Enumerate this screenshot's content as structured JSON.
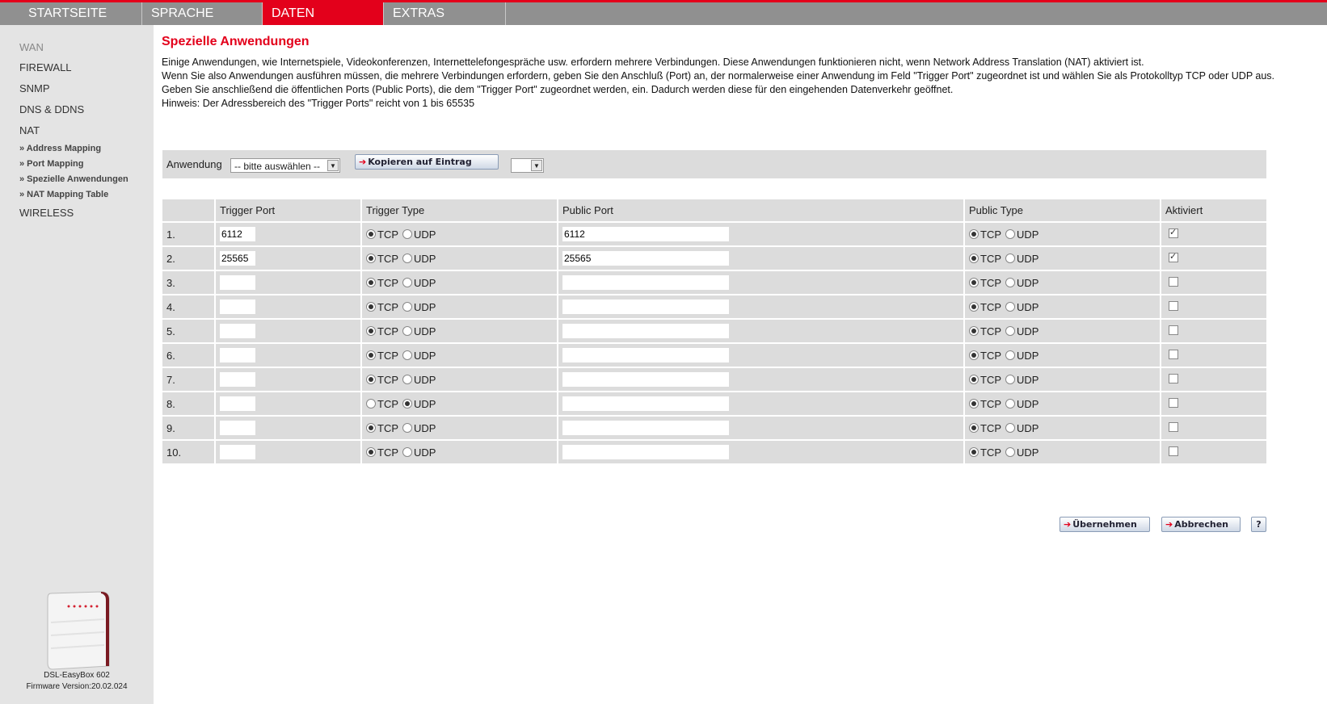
{
  "nav": {
    "tabs": [
      {
        "label": "STARTSEITE",
        "active": false
      },
      {
        "label": "SPRACHE",
        "active": false
      },
      {
        "label": "DATEN",
        "active": true
      },
      {
        "label": "EXTRAS",
        "active": false
      }
    ]
  },
  "sidebar": {
    "items": [
      "WAN",
      "FIREWALL",
      "SNMP",
      "DNS & DDNS",
      "NAT",
      "WIRELESS"
    ],
    "subitems": [
      "» Address Mapping",
      "» Port Mapping",
      "» Spezielle Anwendungen",
      "» NAT Mapping Table"
    ],
    "device_name": "DSL-EasyBox 602",
    "firmware": "Firmware Version:20.02.024"
  },
  "main": {
    "title": "Spezielle Anwendungen",
    "intro": [
      "Einige Anwendungen, wie Internetspiele, Videokonferenzen, Internettelefongespräche usw. erfordern mehrere Verbindungen. Diese Anwendungen funktionieren nicht, wenn Network Address Translation (NAT) aktiviert ist.",
      "Wenn Sie also Anwendungen ausführen müssen, die mehrere Verbindungen erfordern, geben Sie den Anschluß (Port) an, der normalerweise einer Anwendung im Feld \"Trigger Port\" zugeordnet ist und wählen Sie als Protokolltyp TCP oder UDP aus.",
      "Geben Sie anschließend die öffentlichen Ports (Public Ports), die dem \"Trigger Port\" zugeordnet werden, ein. Dadurch werden diese für den eingehenden Datenverkehr geöffnet.",
      "Hinweis: Der Adressbereich des \"Trigger Ports\" reicht von 1 bis 65535"
    ],
    "app_label": "Anwendung",
    "app_select_value": "-- bitte auswählen --",
    "copy_button": "Kopieren auf Eintrag",
    "entry_select_value": ""
  },
  "table": {
    "headers": [
      "",
      "Trigger Port",
      "Trigger Type",
      "Public Port",
      "Public Type",
      "Aktiviert"
    ],
    "tcp_label": "TCP",
    "udp_label": "UDP",
    "rows": [
      {
        "num": "1.",
        "trigger_port": "6112",
        "trigger_type": "TCP",
        "public_port": "6112",
        "public_type": "TCP",
        "active": true
      },
      {
        "num": "2.",
        "trigger_port": "25565",
        "trigger_type": "TCP",
        "public_port": "25565",
        "public_type": "TCP",
        "active": true
      },
      {
        "num": "3.",
        "trigger_port": "",
        "trigger_type": "TCP",
        "public_port": "",
        "public_type": "TCP",
        "active": false
      },
      {
        "num": "4.",
        "trigger_port": "",
        "trigger_type": "TCP",
        "public_port": "",
        "public_type": "TCP",
        "active": false
      },
      {
        "num": "5.",
        "trigger_port": "",
        "trigger_type": "TCP",
        "public_port": "",
        "public_type": "TCP",
        "active": false
      },
      {
        "num": "6.",
        "trigger_port": "",
        "trigger_type": "TCP",
        "public_port": "",
        "public_type": "TCP",
        "active": false
      },
      {
        "num": "7.",
        "trigger_port": "",
        "trigger_type": "TCP",
        "public_port": "",
        "public_type": "TCP",
        "active": false
      },
      {
        "num": "8.",
        "trigger_port": "",
        "trigger_type": "UDP",
        "public_port": "",
        "public_type": "TCP",
        "active": false
      },
      {
        "num": "9.",
        "trigger_port": "",
        "trigger_type": "TCP",
        "public_port": "",
        "public_type": "TCP",
        "active": false
      },
      {
        "num": "10.",
        "trigger_port": "",
        "trigger_type": "TCP",
        "public_port": "",
        "public_type": "TCP",
        "active": false
      }
    ]
  },
  "actions": {
    "apply": "Übernehmen",
    "cancel": "Abbrechen",
    "help": "?"
  },
  "colors": {
    "accent": "#e3001b",
    "nav_bg": "#909090",
    "sidebar_bg": "#e4e4e4",
    "panel_bg": "#dcdcdc"
  }
}
